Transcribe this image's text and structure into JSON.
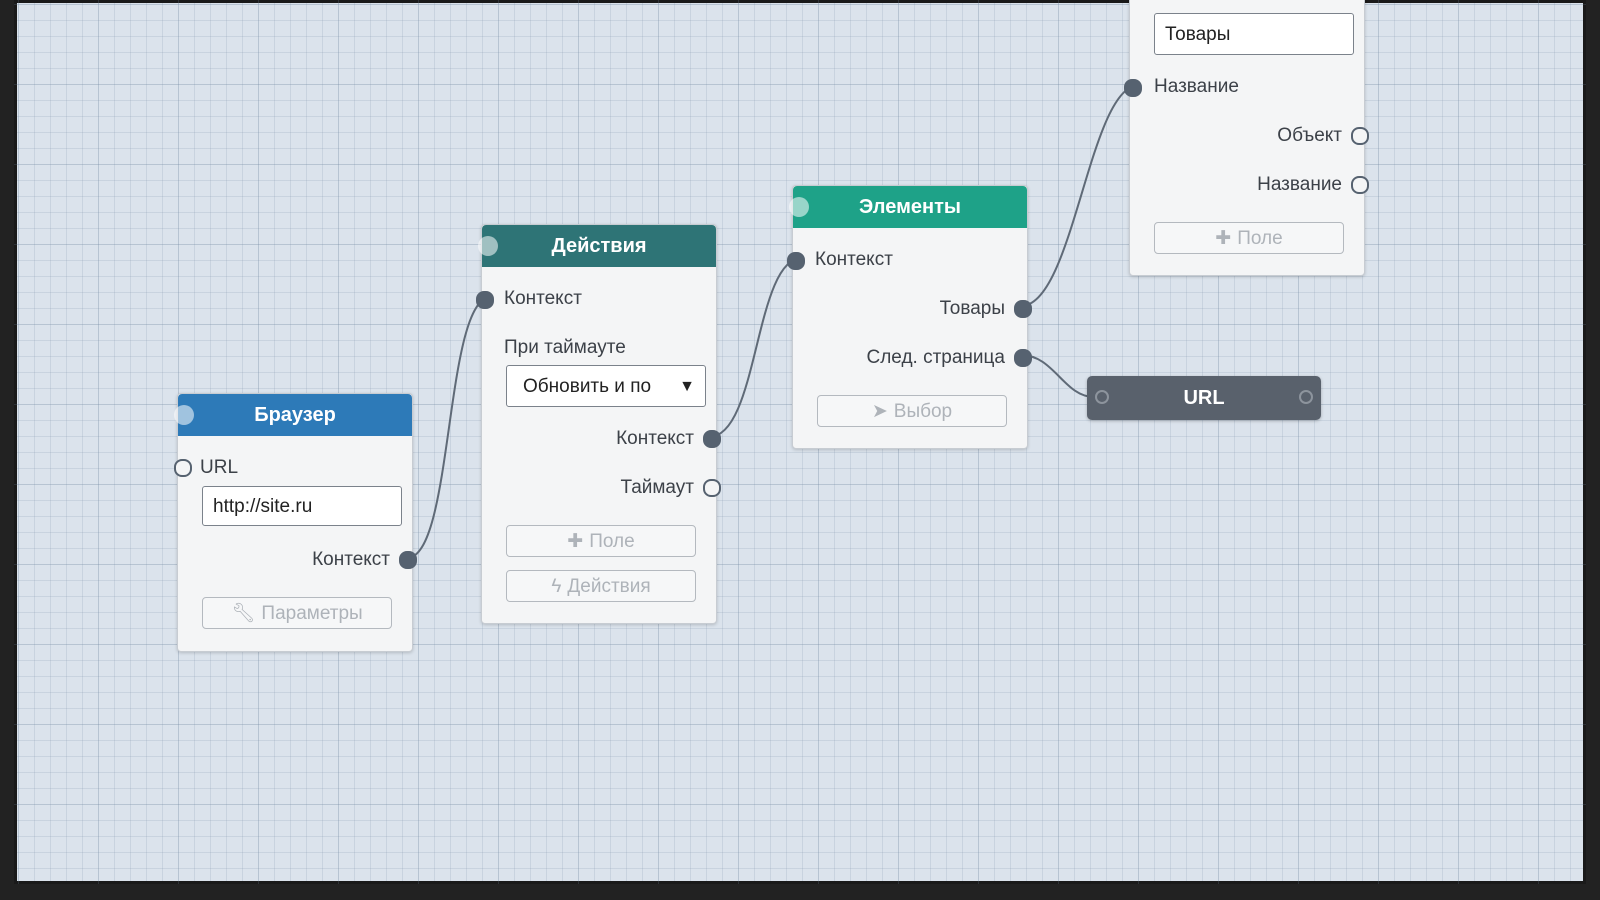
{
  "nodes": {
    "browser": {
      "title": "Браузер",
      "url_label": "URL",
      "url_value": "http://site.ru",
      "context_label": "Контекст",
      "params_button": "Параметры"
    },
    "actions": {
      "title": "Действия",
      "context_in_label": "Контекст",
      "timeout_label": "При таймауте",
      "timeout_select_value": "Обновить и по",
      "context_out_label": "Контекст",
      "timeout_out_label": "Таймаут",
      "field_button": "Поле",
      "actions_button": "Действия"
    },
    "elements": {
      "title": "Элементы",
      "context_label": "Контекст",
      "goods_label": "Товары",
      "next_page_label": "След. страница",
      "select_button": "Выбор"
    },
    "collection": {
      "name_value": "Товары",
      "name_in_label": "Название",
      "object_label": "Объект",
      "name_out_label": "Название",
      "field_button": "Поле"
    },
    "url": {
      "title": "URL"
    }
  },
  "colors": {
    "browser_header": "#2d7ab8",
    "actions_header": "#2e7476",
    "elements_header": "#1ea288",
    "url_node": "#59616c",
    "wire": "#5f6a77"
  },
  "icons": {
    "params": "wrench-icon",
    "field": "plus-icon",
    "actions": "lightning-icon",
    "select": "cursor-icon"
  }
}
